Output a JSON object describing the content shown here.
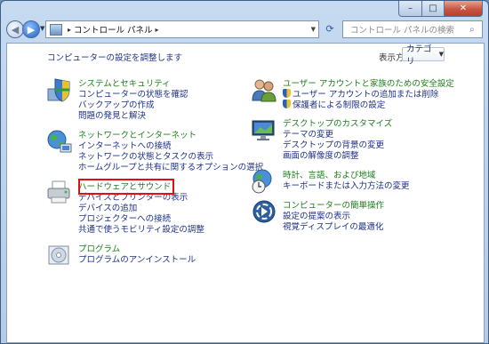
{
  "window": {
    "caption": {
      "minimize": "–",
      "maximize": "□",
      "close": "✕"
    }
  },
  "navbar": {
    "back_icon": "back-arrow",
    "forward_icon": "forward-arrow",
    "address": {
      "breadcrumb": "コントロール パネル"
    },
    "search": {
      "placeholder": "コントロール パネルの検索"
    }
  },
  "main": {
    "heading": "コンピューターの設定を調整します",
    "view_by_label": "表示方法:",
    "view_by_value": "カテゴリ"
  },
  "categories_left": [
    {
      "title": "システムとセキュリティ",
      "icon": "shield-system-icon",
      "links": [
        "コンピューターの状態を確認",
        "バックアップの作成",
        "問題の発見と解決"
      ]
    },
    {
      "title": "ネットワークとインターネット",
      "icon": "network-globe-icon",
      "links": [
        "インターネットへの接続",
        "ネットワークの状態とタスクの表示",
        "ホームグループと共有に関するオプションの選択"
      ]
    },
    {
      "title": "ハードウェアとサウンド",
      "icon": "printer-hardware-icon",
      "links": [
        "デバイスとプリンターの表示",
        "デバイスの追加",
        "プロジェクターへの接続",
        "共通で使うモビリティ設定の調整"
      ]
    },
    {
      "title": "プログラム",
      "icon": "programs-disc-icon",
      "links": [
        "プログラムのアンインストール"
      ]
    }
  ],
  "categories_right": [
    {
      "title": "ユーザー アカウントと家族のための安全設定",
      "icon": "users-icon",
      "links": [
        "ユーザー アカウントの追加または削除",
        "保護者による制限の設定"
      ]
    },
    {
      "title": "デスクトップのカスタマイズ",
      "icon": "desktop-monitor-icon",
      "links": [
        "テーマの変更",
        "デスクトップの背景の変更",
        "画面の解像度の調整"
      ]
    },
    {
      "title": "時計、言語、および地域",
      "icon": "clock-globe-icon",
      "links": [
        "キーボードまたは入力方法の変更"
      ]
    },
    {
      "title": "コンピューターの簡単操作",
      "icon": "ease-of-access-icon",
      "links": [
        "設定の提案の表示",
        "視覚ディスプレイの最適化"
      ]
    }
  ],
  "colors": {
    "title_green": "#1e7e1e",
    "link_blue": "#1e3287",
    "highlight": "#e01010"
  }
}
